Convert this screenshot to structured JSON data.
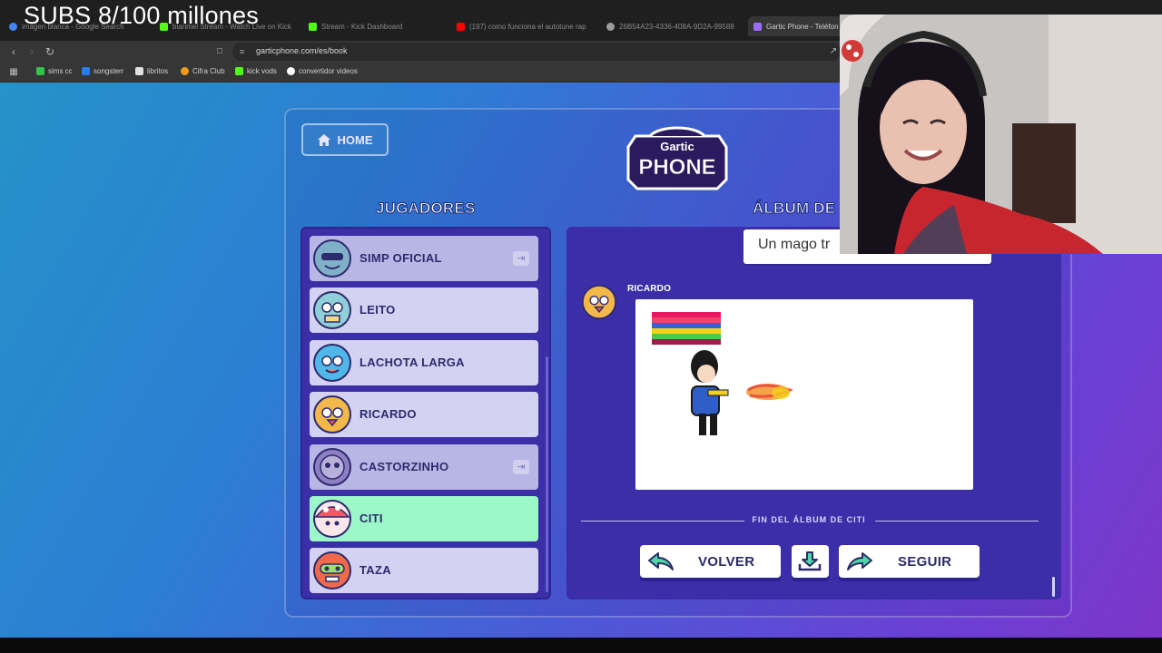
{
  "overlay": {
    "title": "SUBS 8/100 millones"
  },
  "browser": {
    "tabs": [
      {
        "label": "imagen blanca - Google Search",
        "color": "#4285f4"
      },
      {
        "label": "biarimel Stream - Watch Live on Kick",
        "color": "#53fc18"
      },
      {
        "label": "Stream - Kick Dashboard",
        "color": "#53fc18"
      },
      {
        "label": "(197) como funciona el autotune rap",
        "color": "#ff0000"
      },
      {
        "label": "26B54A23-4336-408A-9D2A-99588",
        "color": "#9a9a9a"
      },
      {
        "label": "Gartic Phone - Teléfon",
        "color": "#9b6cf5",
        "active": true
      }
    ],
    "url": "garticphone.com/es/book",
    "bookmarks": [
      {
        "label": "sims cc",
        "color": "#35c24a"
      },
      {
        "label": "songsterr",
        "color": "#2a7cf0"
      },
      {
        "label": "libritos",
        "color": "#e0e0e0"
      },
      {
        "label": "Cifra Club",
        "color": "#f29a1d"
      },
      {
        "label": "kick vods",
        "color": "#53fc18"
      },
      {
        "label": "convertidor videos",
        "color": "#ffffff"
      }
    ]
  },
  "game": {
    "home_label": "HOME",
    "logo": {
      "line1": "Gartic",
      "line2": "PHONE"
    },
    "players_heading": "JUGADORES",
    "album_heading": "ÁLBUM DE",
    "players": [
      {
        "name": "SIMP OFICIAL",
        "state": "dim",
        "kick": true,
        "avatar_color": "#7fb0c8"
      },
      {
        "name": "LEITO",
        "state": "normal",
        "kick": false,
        "avatar_color": "#8fd0d8"
      },
      {
        "name": "LACHOTA LARGA",
        "state": "normal",
        "kick": false,
        "avatar_color": "#4fb8e8"
      },
      {
        "name": "RICARDO",
        "state": "normal",
        "kick": false,
        "avatar_color": "#f2b84a"
      },
      {
        "name": "CASTORZINHO",
        "state": "dim",
        "kick": true,
        "avatar_color": "#8c7fc2"
      },
      {
        "name": "CITI",
        "state": "active",
        "kick": false,
        "avatar_color": "#f25a6a"
      },
      {
        "name": "TAZA",
        "state": "normal",
        "kick": false,
        "avatar_color": "#f06a4a"
      }
    ],
    "caption": "Un mago tr",
    "author": "RICARDO",
    "end_text": "FIN DEL ÁLBUM DE CITI",
    "buttons": {
      "back": "VOLVER",
      "next": "SEGUIR",
      "download": "download-icon"
    },
    "accent": "#9cf7c9"
  }
}
